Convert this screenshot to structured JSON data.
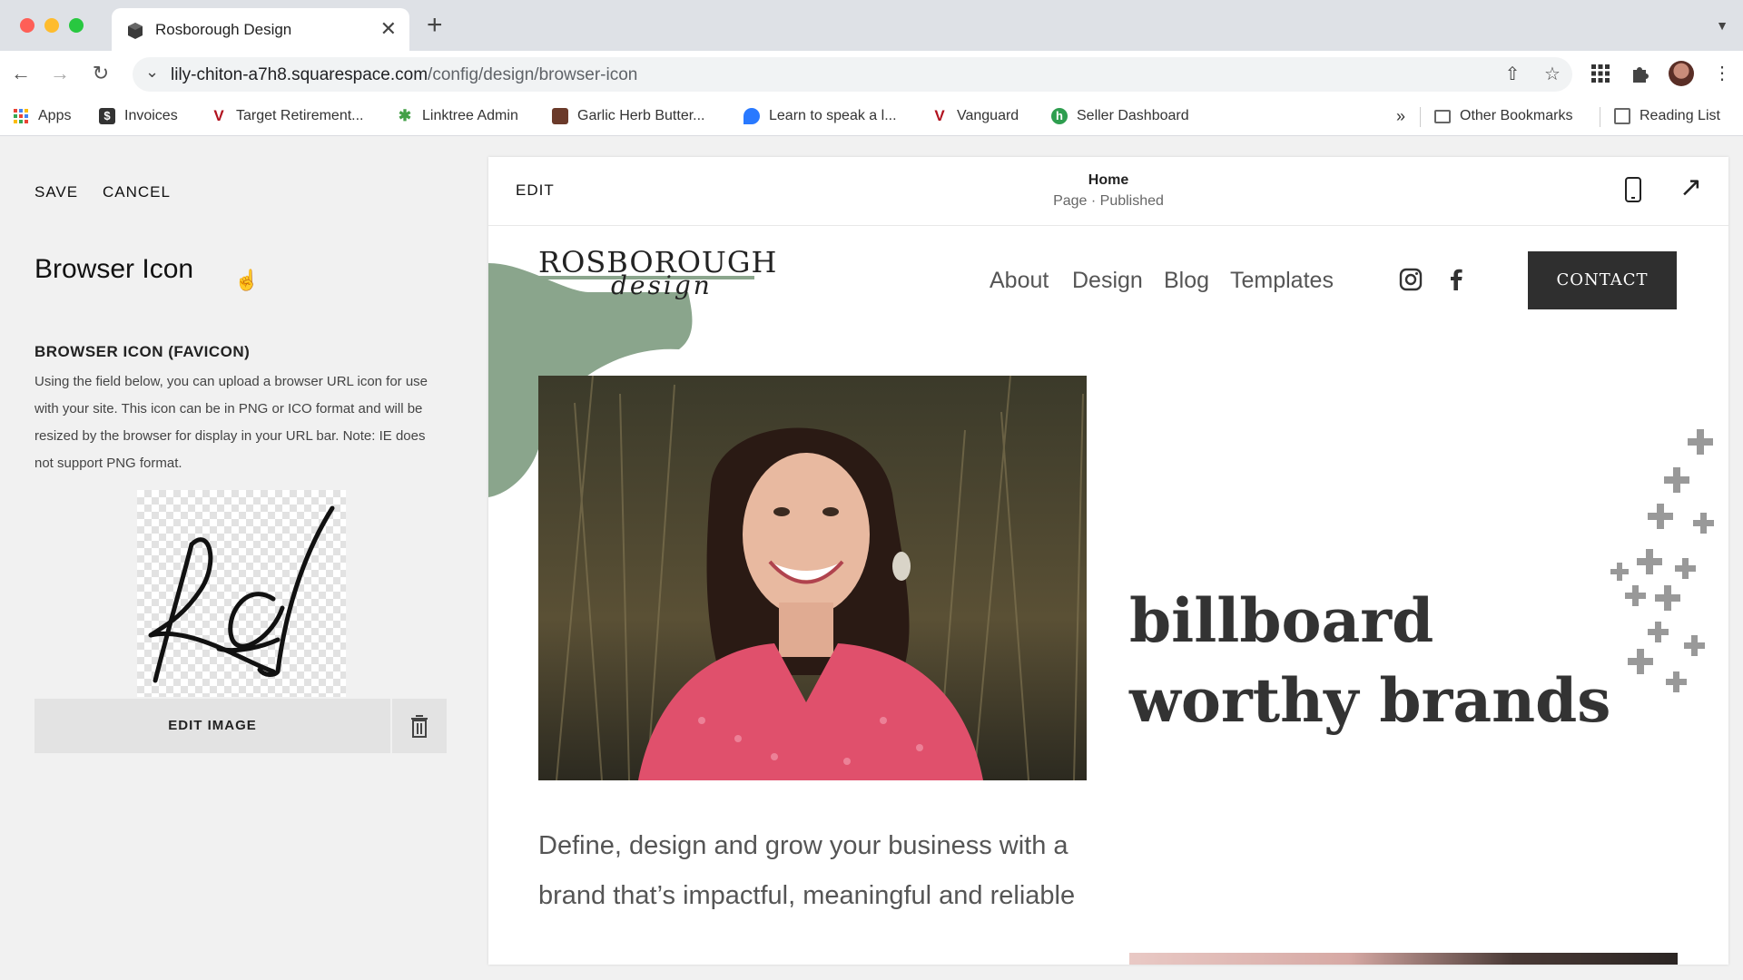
{
  "browser": {
    "tab_title": "Rosborough Design",
    "tab_close": "✕",
    "new_tab": "+",
    "url_main": "lily-chiton-a7h8.squarespace.com",
    "url_path": "/config/design/browser-icon",
    "bookmarks": [
      {
        "label": "Apps",
        "icon": "apps-grid-icon"
      },
      {
        "label": "Invoices",
        "icon": "invoices-icon"
      },
      {
        "label": "Target Retirement...",
        "icon": "vanguard-v-icon"
      },
      {
        "label": "Linktree Admin",
        "icon": "linktree-icon"
      },
      {
        "label": "Garlic Herb Butter...",
        "icon": "recipe-icon"
      },
      {
        "label": "Learn to speak a l...",
        "icon": "language-icon"
      },
      {
        "label": "Vanguard",
        "icon": "vanguard-v-icon"
      },
      {
        "label": "Seller Dashboard",
        "icon": "seller-icon"
      }
    ],
    "bookmarks_overflow": "»",
    "other_bookmarks": "Other Bookmarks",
    "reading_list": "Reading List"
  },
  "panel": {
    "save_label": "SAVE",
    "cancel_label": "CANCEL",
    "title": "Browser Icon",
    "section_title": "BROWSER ICON (FAVICON)",
    "section_desc": "Using the field below, you can upload a browser URL icon for use with your site. This icon can be in PNG or ICO format and will be resized by the browser for display in your URL bar. Note: IE does not support PNG format.",
    "edit_image_label": "EDIT IMAGE"
  },
  "preview": {
    "edit_label": "EDIT",
    "page_name": "Home",
    "page_status": "Page · Published"
  },
  "site": {
    "logo_main": "ROSBOROUGH",
    "logo_script": "design",
    "nav": [
      "About",
      "Design",
      "Blog",
      "Templates"
    ],
    "contact_label": "CONTACT",
    "headline": "billboard worthy brands",
    "intro": "Define, design and grow your business with a brand that’s impactful, meaningful and reliable"
  },
  "colors": {
    "accent_green": "#8aa58c",
    "contact_bg": "#2f2f2f",
    "sweater_pink": "#e0506c"
  }
}
